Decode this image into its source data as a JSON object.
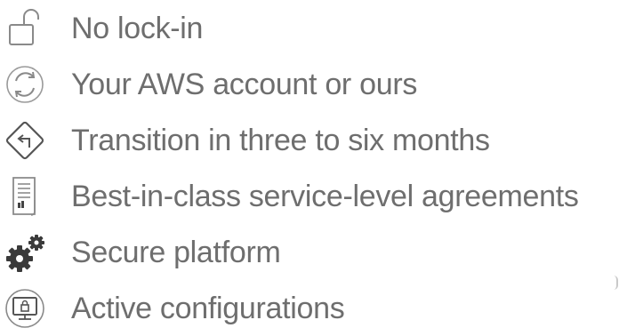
{
  "features": [
    {
      "label": "No lock-in",
      "icon": "open-padlock-icon"
    },
    {
      "label": "Your AWS account or ours",
      "icon": "circular-arrows-icon"
    },
    {
      "label": "Transition in three to six months",
      "icon": "diamond-turn-sign-icon"
    },
    {
      "label": "Best-in-class service-level agreements",
      "icon": "document-chart-icon"
    },
    {
      "label": "Secure platform",
      "icon": "gears-icon"
    },
    {
      "label": "Active configurations",
      "icon": "monitor-lock-icon"
    }
  ],
  "colors": {
    "text": "#6e6e6e",
    "icon_stroke": "#8a8a8a",
    "icon_fill": "#3a3a3a"
  }
}
